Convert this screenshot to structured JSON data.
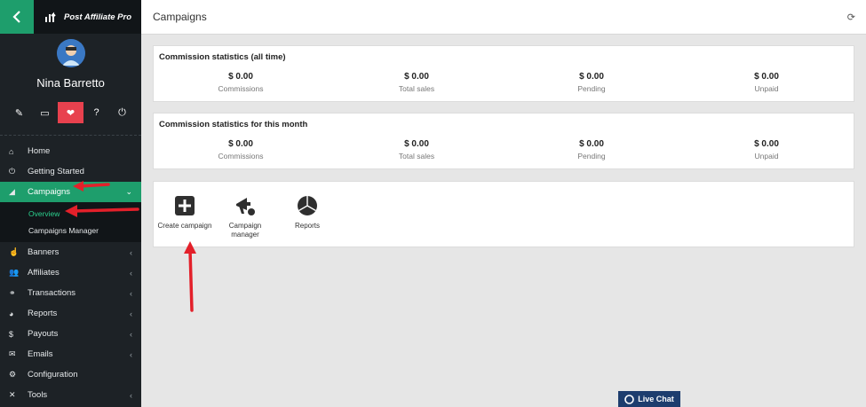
{
  "app": {
    "brand": "Post Affiliate Pro"
  },
  "user": {
    "name": "Nina Barretto"
  },
  "profile_icons": [
    "pencil-icon",
    "monitor-icon",
    "heart-icon",
    "help-icon",
    "power-icon"
  ],
  "profile_icon_glyphs": [
    "✎",
    "▭",
    "❤",
    "?",
    "⏻"
  ],
  "nav": [
    {
      "label": "Home",
      "icon": "home-icon",
      "glyph": "⌂",
      "chevron": false
    },
    {
      "label": "Getting Started",
      "icon": "power-icon",
      "glyph": "⏻",
      "chevron": false
    },
    {
      "label": "Campaigns",
      "icon": "megaphone-icon",
      "glyph": "◢",
      "chevron": true,
      "active": true
    },
    {
      "label": "Banners",
      "icon": "hand-icon",
      "glyph": "☝",
      "chevron": true
    },
    {
      "label": "Affiliates",
      "icon": "users-icon",
      "glyph": "👥",
      "chevron": true
    },
    {
      "label": "Transactions",
      "icon": "handshake-icon",
      "glyph": "⚭",
      "chevron": true
    },
    {
      "label": "Reports",
      "icon": "pie-chart-icon",
      "glyph": "◕",
      "chevron": true
    },
    {
      "label": "Payouts",
      "icon": "money-bag-icon",
      "glyph": "$",
      "chevron": true
    },
    {
      "label": "Emails",
      "icon": "envelope-icon",
      "glyph": "✉",
      "chevron": true
    },
    {
      "label": "Configuration",
      "icon": "gear-icon",
      "glyph": "⚙",
      "chevron": false
    },
    {
      "label": "Tools",
      "icon": "tools-icon",
      "glyph": "✕",
      "chevron": true
    }
  ],
  "subnav": [
    {
      "label": "Overview",
      "active": true
    },
    {
      "label": "Campaigns Manager",
      "active": false
    }
  ],
  "header": {
    "title": "Campaigns"
  },
  "stats_all_time": {
    "title": "Commission statistics (all time)",
    "items": [
      {
        "value": "$ 0.00",
        "label": "Commissions"
      },
      {
        "value": "$ 0.00",
        "label": "Total sales"
      },
      {
        "value": "$ 0.00",
        "label": "Pending"
      },
      {
        "value": "$ 0.00",
        "label": "Unpaid"
      }
    ]
  },
  "stats_month": {
    "title": "Commission statistics for this month",
    "items": [
      {
        "value": "$ 0.00",
        "label": "Commissions"
      },
      {
        "value": "$ 0.00",
        "label": "Total sales"
      },
      {
        "value": "$ 0.00",
        "label": "Pending"
      },
      {
        "value": "$ 0.00",
        "label": "Unpaid"
      }
    ]
  },
  "tiles": [
    {
      "label": "Create campaign",
      "icon": "plus-square-icon"
    },
    {
      "label": "Campaign manager",
      "icon": "megaphone-icon"
    },
    {
      "label": "Reports",
      "icon": "pie-chart-icon"
    }
  ],
  "live_chat": {
    "label": "Live Chat"
  },
  "colors": {
    "accent": "#1e9e6c",
    "active_icon": "#e8414e",
    "sidebar": "#1d2226",
    "annotation_arrow": "#e3202a"
  }
}
